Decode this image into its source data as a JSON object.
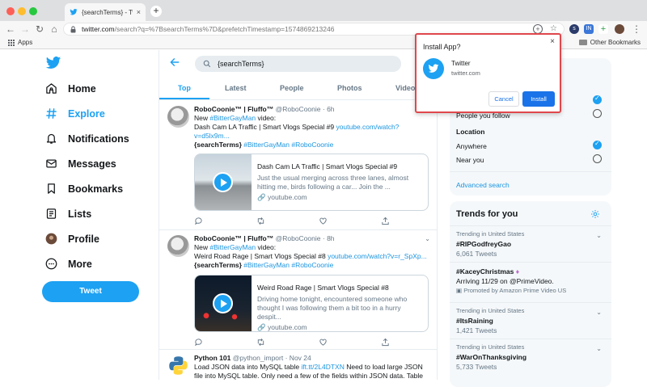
{
  "browser": {
    "tab_title": "{searchTerms} - Twitter Search /",
    "tab_close": "×",
    "new_tab": "+",
    "url_host": "twitter.com",
    "url_path": "/search?q=%7BsearchTerms%7D&prefetchTimestamp=1574869213246",
    "bookmarks": {
      "apps_label": "Apps",
      "other_label": "Other Bookmarks"
    },
    "ext_labels": [
      "IN"
    ]
  },
  "sidebar": {
    "items": [
      {
        "label": "Home",
        "icon": "home-icon"
      },
      {
        "label": "Explore",
        "icon": "hashtag-icon"
      },
      {
        "label": "Notifications",
        "icon": "bell-icon"
      },
      {
        "label": "Messages",
        "icon": "envelope-icon"
      },
      {
        "label": "Bookmarks",
        "icon": "bookmark-icon"
      },
      {
        "label": "Lists",
        "icon": "list-icon"
      },
      {
        "label": "Profile",
        "icon": "avatar-icon"
      },
      {
        "label": "More",
        "icon": "more-icon"
      }
    ],
    "tweet_button": "Tweet"
  },
  "search": {
    "query": "{searchTerms}"
  },
  "tabs": [
    "Top",
    "Latest",
    "People",
    "Photos",
    "Video"
  ],
  "tweets": [
    {
      "name": "RoboCoonie™ | Fluffo™",
      "handle": "@RoboCoonie",
      "time": "· 6h",
      "line1_prefix": "New ",
      "line1_tag": "#BitterGayMan",
      "line1_suffix": " video:",
      "line2_text": "Dash Cam LA Traffic | Smart Vlogs Special #9 ",
      "line2_link": "youtube.com/watch?v=d5lx9m...",
      "line3_bold": "{searchTerms}",
      "line3_tags": " #BitterGayMan #RoboCoonie",
      "card_title": "Dash Cam LA Traffic | Smart Vlogs Special #9",
      "card_desc": "Just the usual merging across three lanes, almost hitting me, birds following a car... Join the ...",
      "card_domain": "youtube.com"
    },
    {
      "name": "RoboCoonie™ | Fluffo™",
      "handle": "@RoboCoonie",
      "time": "· 8h",
      "line1_prefix": "New ",
      "line1_tag": "#BitterGayMan",
      "line1_suffix": " video:",
      "line2_text": "Weird Road Rage | Smart Vlogs Special #8 ",
      "line2_link": "youtube.com/watch?v=r_SpXp...",
      "line3_bold": "{searchTerms}",
      "line3_tags": " #BitterGayMan #RoboCoonie",
      "card_title": "Weird Road Rage | Smart Vlogs Special #8",
      "card_desc": "Driving home tonight, encountered someone who thought I was following them a bit too in a hurry despit...",
      "card_domain": "youtube.com"
    },
    {
      "name": "Python 101",
      "handle": "@python_import",
      "time": "· Nov 24",
      "text_a": "Load JSON data into MySQL table ",
      "link_a": "ift.tt/2L4DTXN",
      "text_b": " Need to load large JSON file into MySQL table. Only need a few of the fields within JSON data. Table fields"
    }
  ],
  "filters": {
    "people_option": "People you follow",
    "location_title": "Location",
    "loc_anywhere": "Anywhere",
    "loc_near": "Near you",
    "advanced": "Advanced search"
  },
  "trends": {
    "title": "Trends for you",
    "items": [
      {
        "context": "Trending in United States",
        "name": "#RIPGodfreyGao",
        "count": "6,061 Tweets"
      },
      {
        "context": "",
        "name": "#KaceyChristmas",
        "desc": "Arriving 11/29 on @PrimeVideo.",
        "promoted": "Promoted by Amazon Prime Video US"
      },
      {
        "context": "Trending in United States",
        "name": "#ItsRaining",
        "count": "1,421 Tweets"
      },
      {
        "context": "Trending in United States",
        "name": "#WarOnThanksgiving",
        "count": "5,733 Tweets"
      }
    ]
  },
  "popup": {
    "title": "Install App?",
    "close": "×",
    "app_name": "Twitter",
    "app_origin": "twitter.com",
    "cancel": "Cancel",
    "install": "Install"
  },
  "colors": {
    "twitter_blue": "#1da1f2",
    "popup_border": "#e0474c",
    "chrome_blue": "#1a73e8"
  }
}
